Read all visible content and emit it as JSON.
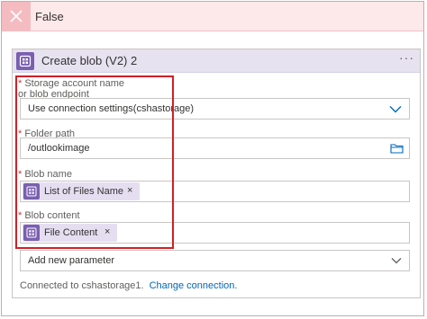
{
  "false_branch": {
    "title": "False"
  },
  "action": {
    "title": "Create blob (V2) 2",
    "more_label": "···",
    "fields": {
      "storage_account": {
        "label_line1": "Storage account name",
        "label_line2": "or blob endpoint",
        "value": "Use connection settings(cshastorage)"
      },
      "folder_path": {
        "label": "Folder path",
        "value": "/outlookimage"
      },
      "blob_name": {
        "label": "Blob name",
        "token": "List of Files Name"
      },
      "blob_content": {
        "label": "Blob content",
        "token": "File Content"
      }
    },
    "add_parameter": "Add new parameter",
    "connection_text": "Connected to cshastorage1.",
    "change_connection": "Change connection."
  },
  "required_marker": "*",
  "token_remove": "×",
  "colors": {
    "accent_purple": "#7b5fb0",
    "false_header_bg": "#fde9ea",
    "highlight_red": "#d21f26",
    "link_blue": "#0067b8"
  },
  "icons": {
    "false_close": "close-icon",
    "action": "blob-storage-icon",
    "dropdown": "chevron-down-icon",
    "folder": "folder-icon"
  }
}
